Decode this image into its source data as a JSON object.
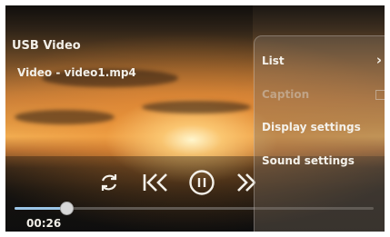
{
  "player": {
    "source_title": "USB Video",
    "filename": "Video - video1.mp4",
    "current_time": "00:26",
    "progress": 0.14
  },
  "controls": {
    "repeat_icon": "repeat-icon",
    "previous_icon": "skip-back-icon",
    "pause_icon": "pause-circle-icon",
    "next_icon": "skip-forward-icon"
  },
  "menu": {
    "items": [
      {
        "label": "List",
        "enabled": true,
        "trailing": "chevron-right-icon"
      },
      {
        "label": "Caption",
        "enabled": false,
        "trailing": "checkbox"
      },
      {
        "label": "Display settings",
        "enabled": true
      },
      {
        "label": "Sound settings",
        "enabled": true
      }
    ]
  },
  "colors": {
    "accent_seek": "#9bc6e8",
    "text": "#f2efe8"
  }
}
